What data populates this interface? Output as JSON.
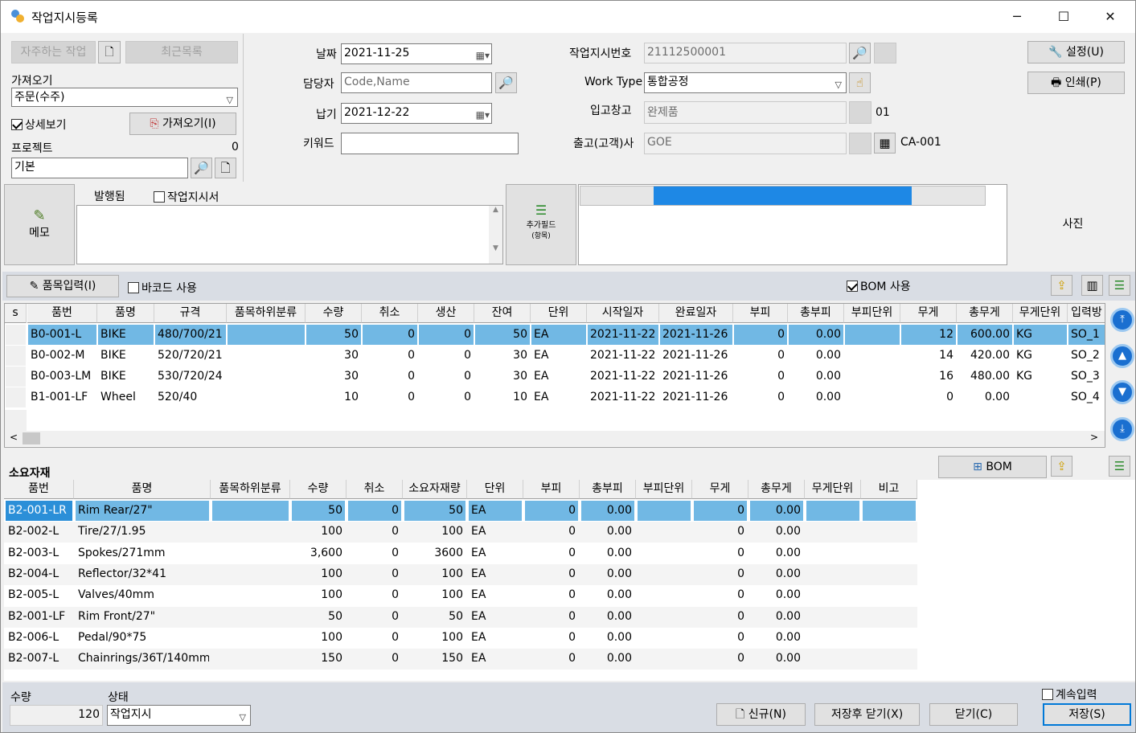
{
  "window": {
    "title": "작업지시등록",
    "min": "─",
    "max": "☐",
    "close": "✕"
  },
  "left": {
    "fav_btn": "자주하는 작업",
    "recent_btn": "최근목록",
    "import_label": "가져오기",
    "import_value": "주문(수주)",
    "detail_check": "상세보기",
    "import_btn": "가져오기(I)",
    "project_label": "프로젝트",
    "project_count": "0",
    "project_value": "기본"
  },
  "mid": {
    "date_label": "날짜",
    "date_value": "2021-11-25",
    "manager_label": "담당자",
    "manager_placeholder": "Code,Name",
    "due_label": "납기",
    "due_value": "2021-12-22",
    "keyword_label": "키워드",
    "keyword_value": ""
  },
  "right": {
    "order_no_label": "작업지시번호",
    "order_no_value": "21112500001",
    "work_type_label": "Work Type",
    "work_type_value": "통합공정",
    "warehouse_label": "입고창고",
    "warehouse_value": "완제품",
    "warehouse_code": "01",
    "customer_label": "출고(고객)사",
    "customer_value": "GOE",
    "customer_code": "CA-001"
  },
  "actions": {
    "settings": "설정(U)",
    "print": "인쇄(P)"
  },
  "memo": {
    "btn": "메모",
    "issued": "발행됨",
    "sheet_check": "작업지시서",
    "extra_field": "추가필드",
    "extra_field_sub": "(항목)",
    "photo": "사진",
    "progress": 0.82
  },
  "item_toolbar": {
    "item_input": "품목입력(I)",
    "barcode": "바코드 사용",
    "bom_use": "BOM 사용"
  },
  "items": {
    "columns": [
      "s",
      "품번",
      "품명",
      "규격",
      "품목하위분류",
      "수량",
      "취소",
      "생산",
      "잔여",
      "단위",
      "시작일자",
      "완료일자",
      "부피",
      "총부피",
      "부피단위",
      "무게",
      "총무게",
      "무게단위",
      "입력방"
    ],
    "rows": [
      [
        "",
        "B0-001-L",
        "BIKE",
        "480/700/21",
        "",
        "50",
        "0",
        "0",
        "50",
        "EA",
        "2021-11-22",
        "2021-11-26",
        "0",
        "0.00",
        "",
        "12",
        "600.00",
        "KG",
        "SO_1"
      ],
      [
        "",
        "B0-002-M",
        "BIKE",
        "520/720/21",
        "",
        "30",
        "0",
        "0",
        "30",
        "EA",
        "2021-11-22",
        "2021-11-26",
        "0",
        "0.00",
        "",
        "14",
        "420.00",
        "KG",
        "SO_2"
      ],
      [
        "",
        "B0-003-LM",
        "BIKE",
        "530/720/24",
        "",
        "30",
        "0",
        "0",
        "30",
        "EA",
        "2021-11-22",
        "2021-11-26",
        "0",
        "0.00",
        "",
        "16",
        "480.00",
        "KG",
        "SO_3"
      ],
      [
        "",
        "B1-001-LF",
        "Wheel",
        "520/40",
        "",
        "10",
        "0",
        "0",
        "10",
        "EA",
        "2021-11-22",
        "2021-11-26",
        "0",
        "0.00",
        "",
        "0",
        "0.00",
        "",
        "SO_4"
      ]
    ]
  },
  "materials": {
    "title": "소요자재",
    "bom_btn": "BOM",
    "columns": [
      "품번",
      "품명",
      "품목하위분류",
      "수량",
      "취소",
      "소요자재량",
      "단위",
      "부피",
      "총부피",
      "부피단위",
      "무게",
      "총무게",
      "무게단위",
      "비고"
    ],
    "rows": [
      [
        "B2-001-LR",
        "Rim Rear/27\"",
        "",
        "50",
        "0",
        "50",
        "EA",
        "0",
        "0.00",
        "",
        "0",
        "0.00",
        "",
        ""
      ],
      [
        "B2-002-L",
        "Tire/27/1.95",
        "",
        "100",
        "0",
        "100",
        "EA",
        "0",
        "0.00",
        "",
        "0",
        "0.00",
        "",
        ""
      ],
      [
        "B2-003-L",
        "Spokes/271mm",
        "",
        "3,600",
        "0",
        "3600",
        "EA",
        "0",
        "0.00",
        "",
        "0",
        "0.00",
        "",
        ""
      ],
      [
        "B2-004-L",
        "Reflector/32*41",
        "",
        "100",
        "0",
        "100",
        "EA",
        "0",
        "0.00",
        "",
        "0",
        "0.00",
        "",
        ""
      ],
      [
        "B2-005-L",
        "Valves/40mm",
        "",
        "100",
        "0",
        "100",
        "EA",
        "0",
        "0.00",
        "",
        "0",
        "0.00",
        "",
        ""
      ],
      [
        "B2-001-LF",
        "Rim Front/27\"",
        "",
        "50",
        "0",
        "50",
        "EA",
        "0",
        "0.00",
        "",
        "0",
        "0.00",
        "",
        ""
      ],
      [
        "B2-006-L",
        "Pedal/90*75",
        "",
        "100",
        "0",
        "100",
        "EA",
        "0",
        "0.00",
        "",
        "0",
        "0.00",
        "",
        ""
      ],
      [
        "B2-007-L",
        "Chainrings/36T/140mm",
        "",
        "150",
        "0",
        "150",
        "EA",
        "0",
        "0.00",
        "",
        "0",
        "0.00",
        "",
        ""
      ]
    ]
  },
  "bottom": {
    "qty_label": "수량",
    "qty_value": "120",
    "status_label": "상태",
    "status_value": "작업지시",
    "continue_check": "계속입력",
    "new_btn": "신규(N)",
    "save_close_btn": "저장후 닫기(X)",
    "close_btn": "닫기(C)",
    "save_btn": "저장(S)"
  }
}
